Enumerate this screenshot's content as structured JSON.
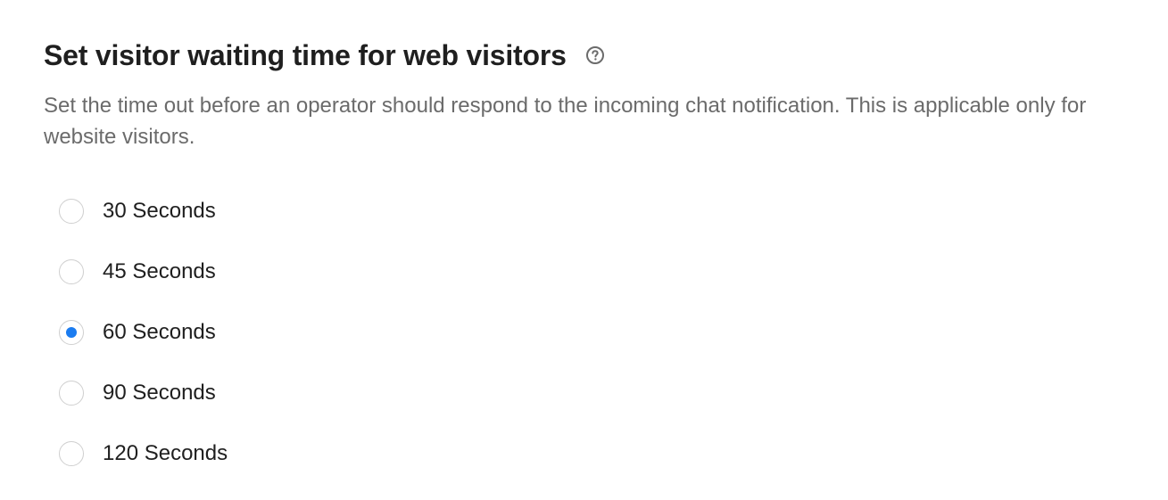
{
  "section": {
    "title": "Set visitor waiting time for web visitors",
    "help_icon": "question-circle-icon",
    "description": "Set the time out before an operator should respond to the incoming chat notification. This is applicable only for website visitors."
  },
  "waiting_time": {
    "selected": "60 Seconds",
    "accent_color": "#1b7cf0",
    "options": [
      {
        "label": "30 Seconds",
        "selected": false
      },
      {
        "label": "45 Seconds",
        "selected": false
      },
      {
        "label": "60 Seconds",
        "selected": true
      },
      {
        "label": "90 Seconds",
        "selected": false
      },
      {
        "label": "120 Seconds",
        "selected": false
      }
    ]
  }
}
